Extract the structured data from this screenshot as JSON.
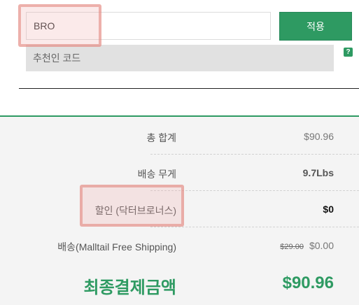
{
  "coupon": {
    "value": "BRO",
    "apply_label": "적용"
  },
  "referral": {
    "placeholder": "추천인 코드",
    "help_icon": "?"
  },
  "summary": {
    "total_label": "총 합계",
    "total_value": "$90.96",
    "weight_label": "배송 무게",
    "weight_value": "9.7Lbs",
    "discount_label": "할인 (닥터브로너스)",
    "discount_value": "$0",
    "shipping_label": "배송(Malltail Free Shipping)",
    "shipping_original": "$29.00",
    "shipping_value": "$0.00",
    "final_label": "최종결제금액",
    "final_value": "$90.96"
  },
  "colors": {
    "accent_green": "#2e9a62",
    "highlight": "#e2827a"
  }
}
